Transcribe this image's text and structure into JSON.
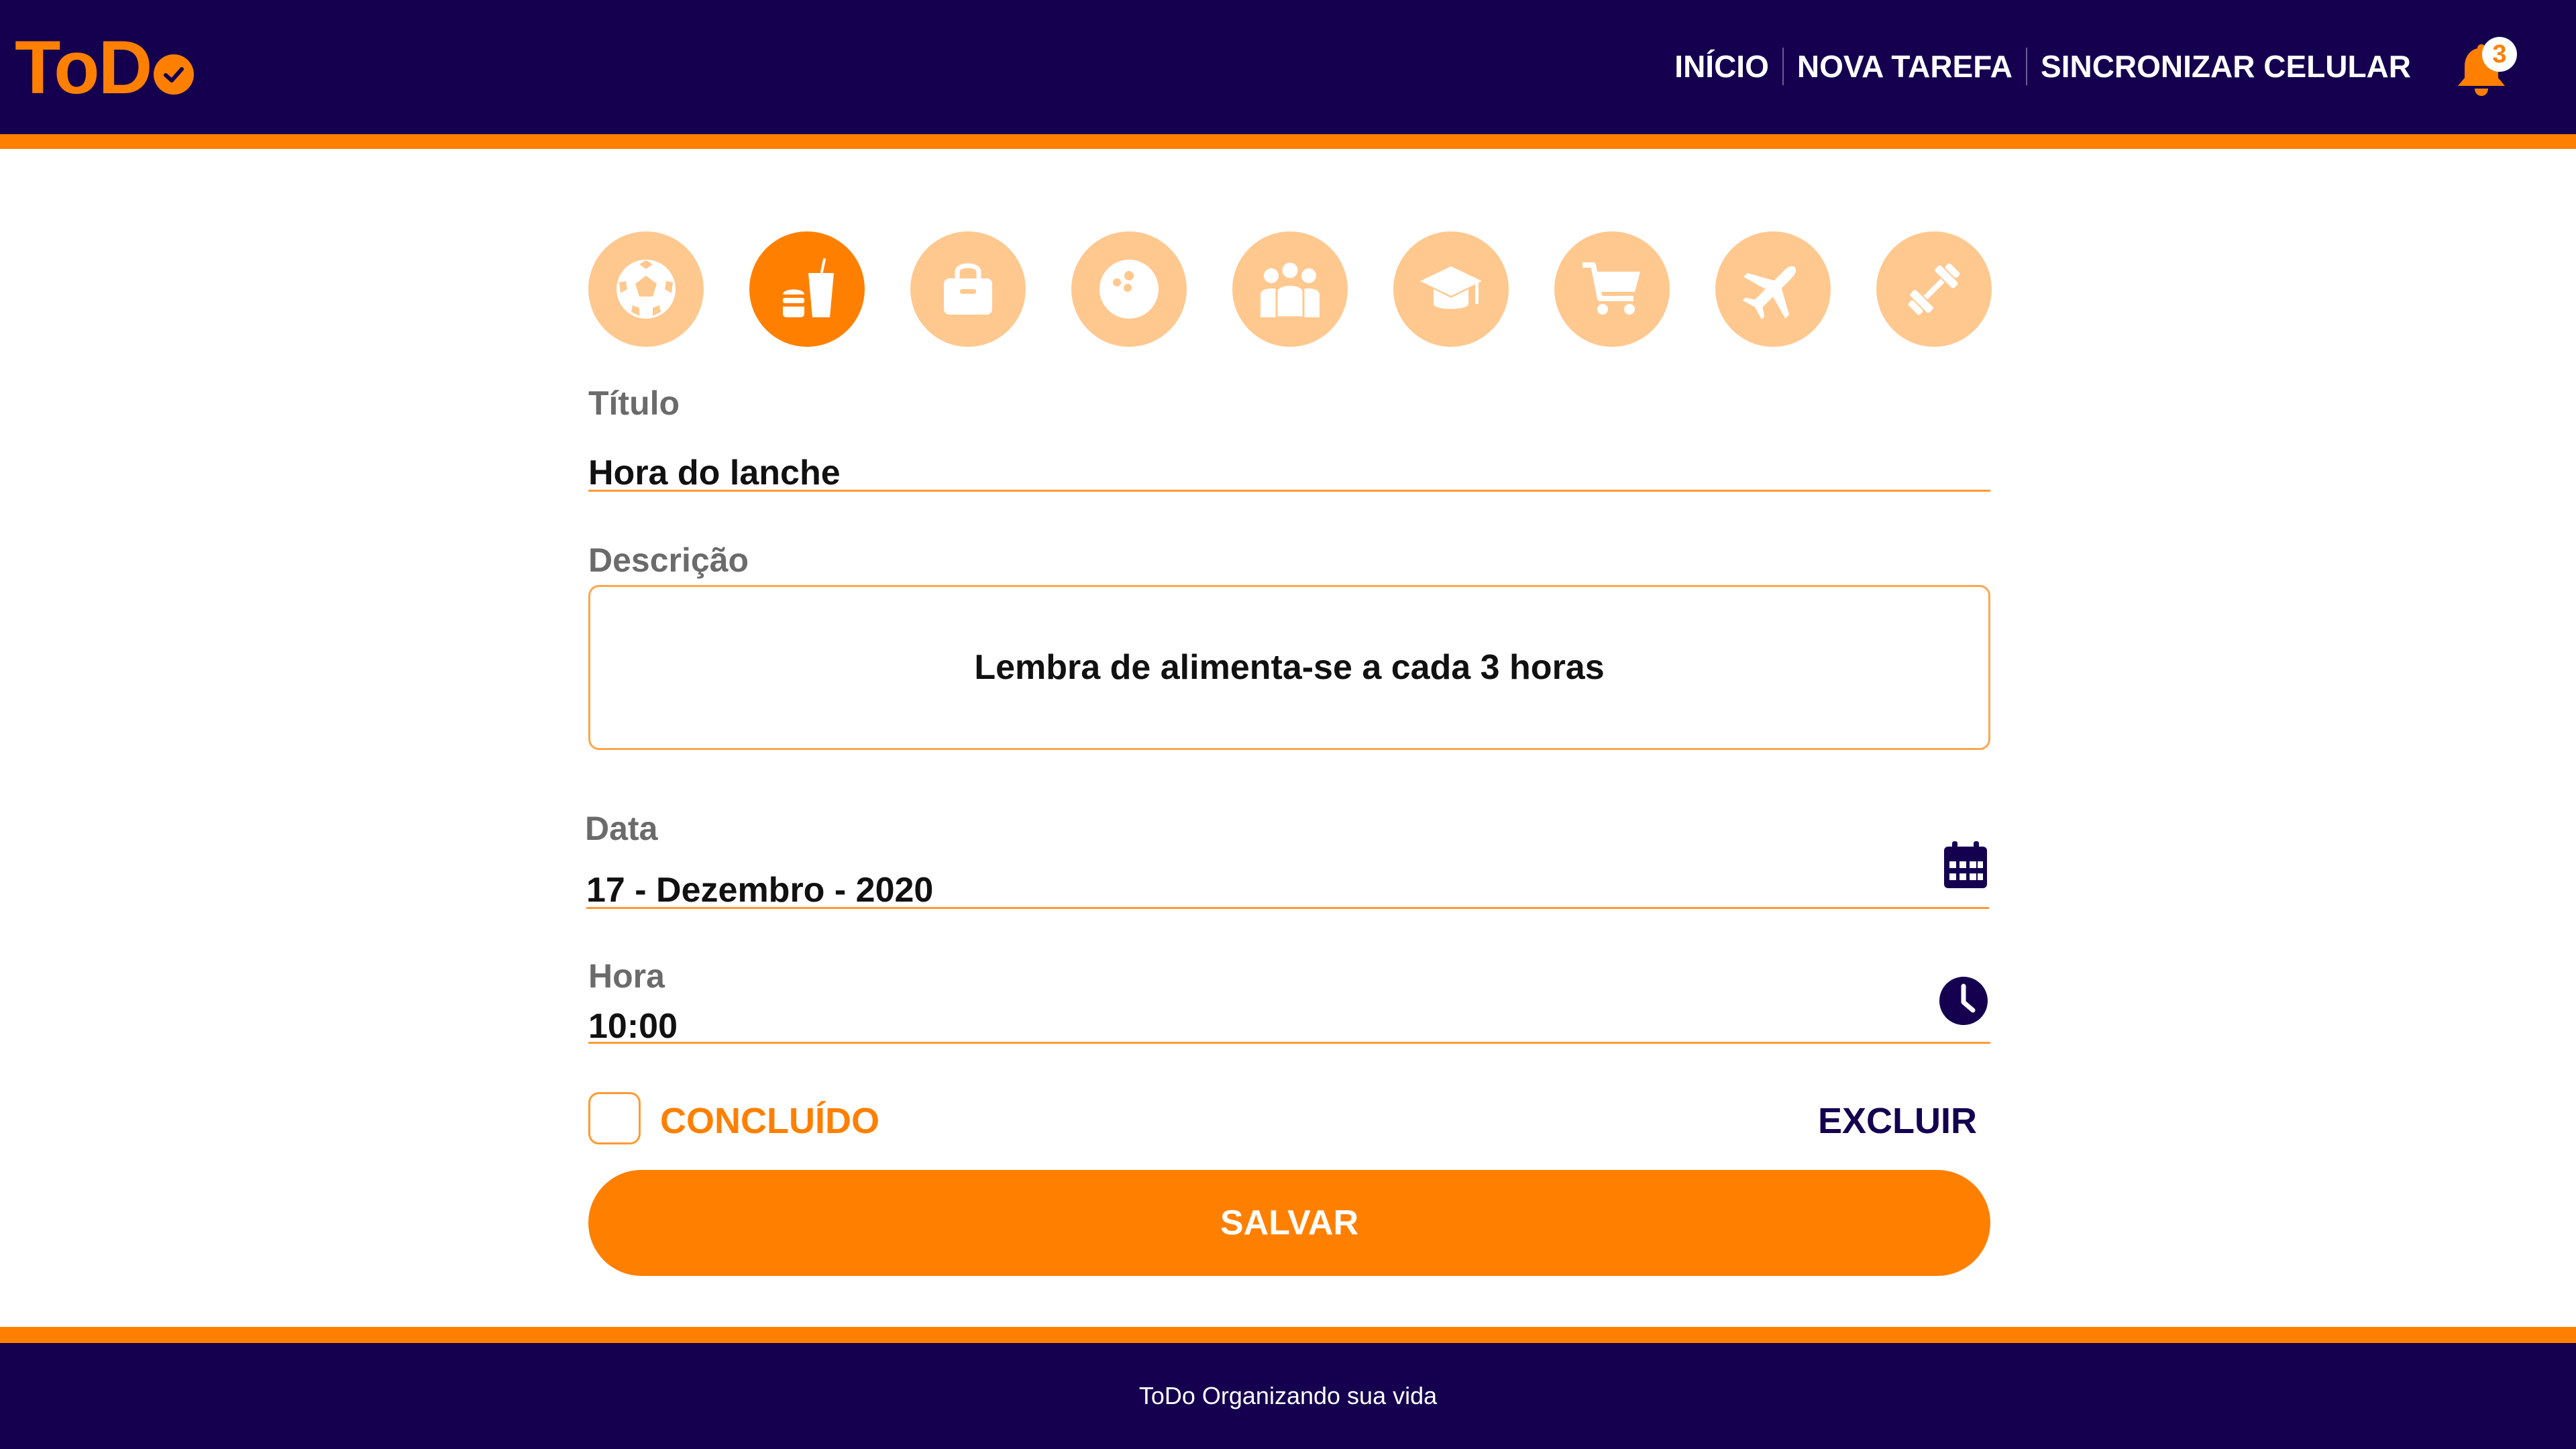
{
  "app": {
    "logo_text": "ToD",
    "logo_suffix_icon": "check-circle-icon"
  },
  "nav": {
    "items": [
      {
        "label": "INÍCIO"
      },
      {
        "label": "NOVA TAREFA"
      },
      {
        "label": "SINCRONIZAR CELULAR"
      }
    ],
    "notifications": {
      "icon": "bell-icon",
      "count": "3"
    }
  },
  "categories": [
    {
      "icon": "soccer-ball-icon",
      "selected": false
    },
    {
      "icon": "food-drink-icon",
      "selected": true
    },
    {
      "icon": "shopping-bag-icon",
      "selected": false
    },
    {
      "icon": "bowling-ball-icon",
      "selected": false
    },
    {
      "icon": "people-group-icon",
      "selected": false
    },
    {
      "icon": "graduation-cap-icon",
      "selected": false
    },
    {
      "icon": "shopping-cart-icon",
      "selected": false
    },
    {
      "icon": "airplane-icon",
      "selected": false
    },
    {
      "icon": "dumbbell-icon",
      "selected": false
    }
  ],
  "form": {
    "title_label": "Título",
    "title_value": "Hora do lanche",
    "description_label": "Descrição",
    "description_value": "Lembra de alimenta-se a cada 3 horas",
    "date_label": "Data",
    "date_value": "17 - Dezembro - 2020",
    "date_icon": "calendar-icon",
    "time_label": "Hora",
    "time_value": "10:00",
    "time_icon": "clock-icon",
    "done_label": "CONCLUÍDO",
    "done_checked": false,
    "delete_label": "EXCLUIR",
    "save_label": "SALVAR"
  },
  "footer": {
    "text": "ToDo Organizando sua vida"
  },
  "colors": {
    "primary": "#150050",
    "accent": "#ff8000",
    "accent_light": "#ffc88f"
  }
}
